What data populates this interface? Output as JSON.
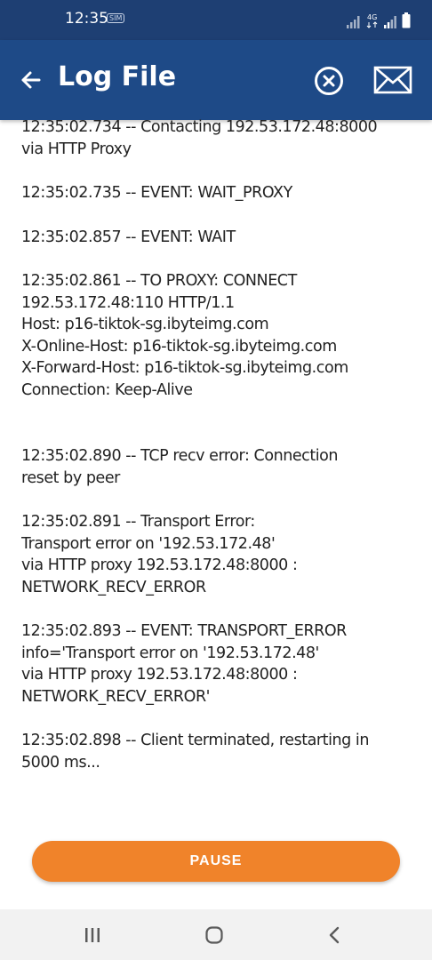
{
  "status_bar": {
    "time": "12:35",
    "sim_badge": "SIM"
  },
  "app_bar": {
    "title": "Log File"
  },
  "log_entries": [
    {
      "lines": [
        "12:35:02.734 -- Contacting 192.53.172.48:8000",
        "via HTTP Proxy"
      ]
    },
    {
      "lines": [
        "12:35:02.735 -- EVENT: WAIT_PROXY"
      ]
    },
    {
      "lines": [
        "12:35:02.857 -- EVENT: WAIT"
      ]
    },
    {
      "lines": [
        "12:35:02.861 -- TO PROXY: CONNECT",
        "192.53.172.48:110 HTTP/1.1",
        "Host: p16-tiktok-sg.ibyteimg.com",
        "X-Online-Host: p16-tiktok-sg.ibyteimg.com",
        "X-Forward-Host: p16-tiktok-sg.ibyteimg.com",
        "Connection: Keep-Alive"
      ]
    },
    {
      "lines": [
        "12:35:02.890 -- TCP recv error: Connection",
        "reset by peer"
      ]
    },
    {
      "lines": [
        "12:35:02.891 -- Transport Error:",
        "Transport error on '192.53.172.48'",
        "via HTTP proxy 192.53.172.48:8000 :",
        "NETWORK_RECV_ERROR"
      ]
    },
    {
      "lines": [
        "12:35:02.893 -- EVENT: TRANSPORT_ERROR",
        "info='Transport error on '192.53.172.48'",
        "via HTTP proxy 192.53.172.48:8000 :",
        "NETWORK_RECV_ERROR'"
      ]
    },
    {
      "lines": [
        "12:35:02.898 -- Client terminated, restarting in",
        "5000 ms..."
      ]
    }
  ],
  "pause_button": {
    "label": "PAUSE"
  },
  "colors": {
    "status_bar": "#1e3f73",
    "app_bar": "#1e4a87",
    "accent": "#f0832a",
    "text": "#222222"
  },
  "icons": [
    "back-arrow-icon",
    "close-circle-icon",
    "mail-icon",
    "recents-icon",
    "home-icon",
    "back-chevron-icon"
  ]
}
